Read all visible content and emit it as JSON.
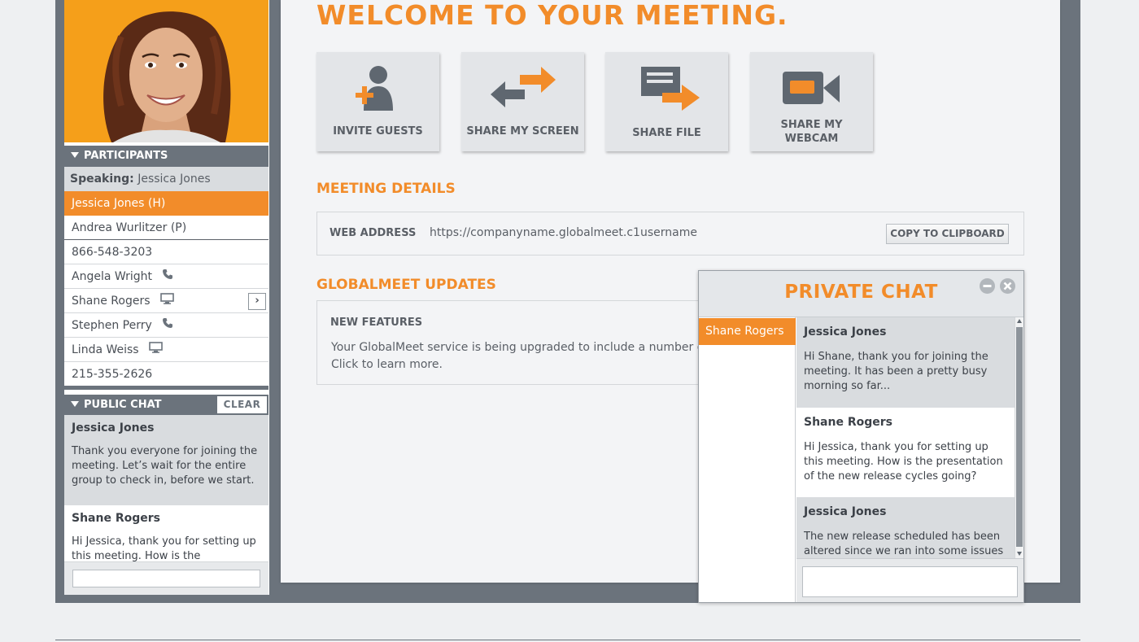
{
  "sidebar": {
    "participants_header": "PARTICIPANTS",
    "speaking_label": "Speaking:",
    "speaking_name": "Jessica Jones",
    "participants": [
      {
        "name": "Jessica Jones (H)",
        "icon": ""
      },
      {
        "name": "Andrea Wurlitzer (P)",
        "icon": ""
      },
      {
        "name": "866-548-3203",
        "icon": ""
      },
      {
        "name": "Angela Wright",
        "icon": "phone-icon"
      },
      {
        "name": "Shane Rogers",
        "icon": "monitor-icon"
      },
      {
        "name": "Stephen Perry",
        "icon": "phone-icon"
      },
      {
        "name": "Linda Weiss",
        "icon": "monitor-icon"
      },
      {
        "name": "215-355-2626",
        "icon": ""
      }
    ],
    "public_chat_header": "PUBLIC CHAT",
    "clear_label": "CLEAR",
    "public_messages": [
      {
        "author": "Jessica Jones",
        "text": "Thank you everyone for joining the meeting. Let’s wait for the entire group to check in, before we start."
      },
      {
        "author": "Shane Rogers",
        "text": "Hi Jessica, thank you for setting up this meeting. How is the presentation"
      }
    ]
  },
  "main": {
    "welcome": "WELCOME TO YOUR MEETING.",
    "tiles": [
      {
        "label": "INVITE GUESTS"
      },
      {
        "label": "SHARE MY SCREEN"
      },
      {
        "label": "SHARE FILE"
      },
      {
        "label": "SHARE MY",
        "label2": "WEBCAM"
      }
    ],
    "meeting_details_title": "MEETING DETAILS",
    "web_address_label": "WEB ADDRESS",
    "web_address_value": "https://companyname.globalmeet.c1username",
    "copy_label": "COPY TO CLIPBOARD",
    "updates_title": "GLOBALMEET UPDATES",
    "new_features_label": "NEW FEATURES",
    "updates_text_1": "Your GlobalMeet service is being upgraded to include a number of ne",
    "updates_text_2": "Click to learn more."
  },
  "private_chat": {
    "title": "PRIVATE CHAT",
    "contact": "Shane Rogers",
    "messages": [
      {
        "author": "Jessica Jones",
        "text": "Hi Shane, thank you for joining the meeting. It has been a pretty busy morning so far..."
      },
      {
        "author": "Shane Rogers",
        "text": "Hi Jessica, thank you for setting up this meeting. How is the presentation of the new release cycles going?"
      },
      {
        "author": "Jessica Jones",
        "text": "The new release scheduled has been altered since we ran into some issues"
      }
    ]
  },
  "colors": {
    "accent": "#f28c2a",
    "slate": "#6b737c"
  }
}
